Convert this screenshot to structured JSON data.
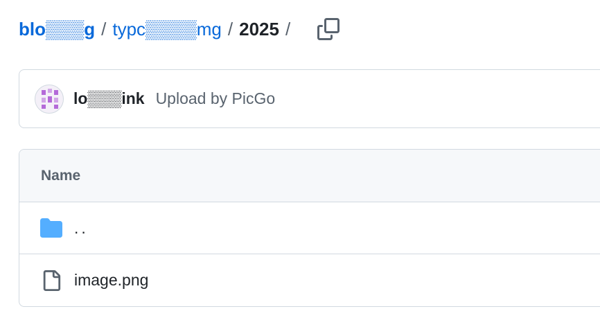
{
  "breadcrumb": {
    "repo": "blo▒▒▒g",
    "folder": "typc▒▒▒▒mg",
    "current": "2025",
    "separator": "/"
  },
  "commit": {
    "author": "lo▒▒▒ink",
    "message": "Upload by PicGo"
  },
  "table": {
    "header": "Name",
    "rows": [
      {
        "name": "..",
        "icon": "folder-icon"
      },
      {
        "name": "image.png",
        "icon": "file-icon"
      }
    ]
  },
  "colors": {
    "link": "#0969da",
    "folder": "#54aeff",
    "muted": "#59636e",
    "border": "#d1d9e0"
  }
}
